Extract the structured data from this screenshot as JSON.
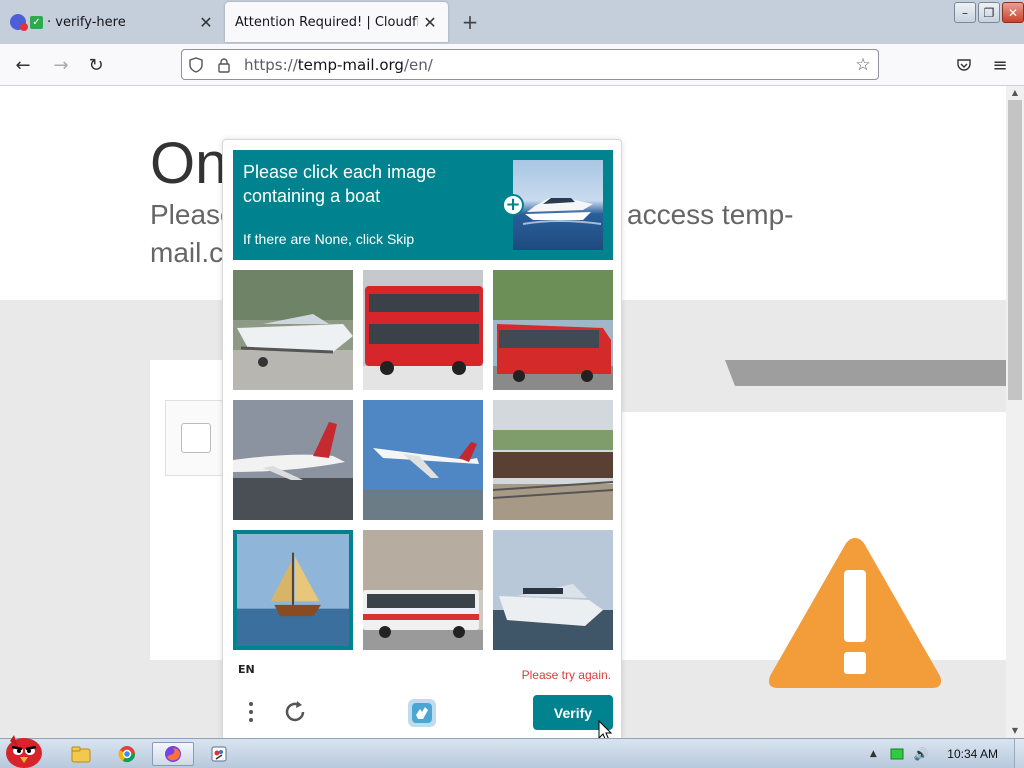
{
  "tabs": [
    {
      "label": "· verify-here",
      "close": "✕"
    },
    {
      "label": "Attention Required! | Cloudflare",
      "close": "✕"
    }
  ],
  "new_tab_icon": "+",
  "nav": {
    "back": "←",
    "forward": "→",
    "reload": "↻",
    "url_scheme": "https://",
    "url_host": "temp-mail.org",
    "url_path": "/en/",
    "bookmark_icon": "☆",
    "pocket_icon": "pocket-icon",
    "menu_icon": "≡"
  },
  "window_controls": {
    "minimize": "–",
    "restore": "❐",
    "close": "✕"
  },
  "page": {
    "heading_fragment": "On",
    "sub_l1": "Please",
    "sub_l2": "mail.c",
    "sub_right": "access temp-"
  },
  "challenge": {
    "prompt_line": "Please click each image containing a boat",
    "prompt_sub": "If there are None, click Skip",
    "plus_icon": "+",
    "tiles": [
      {
        "subject": "motorboat",
        "selected": false
      },
      {
        "subject": "double-decker-bus",
        "selected": false
      },
      {
        "subject": "red-bus",
        "selected": false
      },
      {
        "subject": "airplane-ground",
        "selected": false
      },
      {
        "subject": "airplane-sky",
        "selected": false
      },
      {
        "subject": "train",
        "selected": false
      },
      {
        "subject": "sailboat",
        "selected": true
      },
      {
        "subject": "city-bus",
        "selected": false
      },
      {
        "subject": "yacht",
        "selected": false
      }
    ],
    "language": "EN",
    "error": "Please try again.",
    "verify_label": "Verify"
  },
  "taskbar": {
    "clock": "10:34 AM",
    "tray_arrow": "▲",
    "volume_icon": "🔊"
  },
  "colors": {
    "accent": "#00838f",
    "error": "#d73e3e",
    "warning": "#f39c3a"
  }
}
